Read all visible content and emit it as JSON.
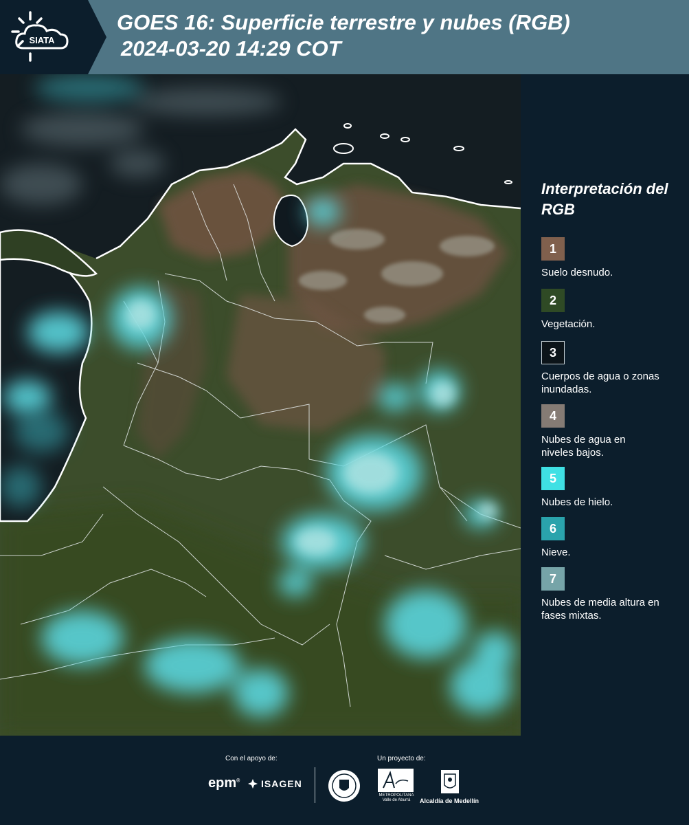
{
  "header": {
    "logo_text": "SIATA",
    "title_line1": "GOES 16: Superficie terrestre y nubes (RGB)",
    "title_line2": "2024-03-20 14:29 COT"
  },
  "legend": {
    "title": "Interpretación del RGB",
    "items": [
      {
        "number": "1",
        "label": "Suelo desnudo.",
        "color": "#80604d"
      },
      {
        "number": "2",
        "label": "Vegetación.",
        "color": "#2f4a25"
      },
      {
        "number": "3",
        "label": "Cuerpos de agua o zonas inundadas.",
        "color": "#0c1419"
      },
      {
        "number": "4",
        "label": "Nubes de agua en niveles bajos.",
        "color": "#857b74"
      },
      {
        "number": "5",
        "label": "Nubes de hielo.",
        "color": "#3fe0e4"
      },
      {
        "number": "6",
        "label": "Nieve.",
        "color": "#2aa3ac"
      },
      {
        "number": "7",
        "label": "Nubes de media altura en fases mixtas.",
        "color": "#76a4a8"
      }
    ]
  },
  "footer": {
    "support_label": "Con el apoyo de:",
    "project_label": "Un proyecto de:",
    "sponsor_epm": "epm",
    "sponsor_isagen": "ISAGEN",
    "area_metropolitana": "METROPOLITANA Valle de Aburrá",
    "alcaldia": "Alcaldía de Medellín"
  },
  "colors": {
    "header_bg": "#4f7585",
    "panel_bg": "#0c1e2c",
    "text": "#ffffff"
  }
}
